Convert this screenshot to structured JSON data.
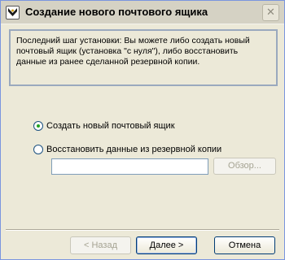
{
  "window": {
    "title": "Создание нового почтового ящика",
    "close_label": "✕"
  },
  "info": {
    "text": "Последний шаг установки: Вы можете либо создать новый почтовый ящик (установка \"с нуля\"), либо восстановить данные из ранее сделанной резервной копии."
  },
  "options": {
    "create_label": "Создать новый почтовый ящик",
    "restore_label": "Восстановить данные из резервной копии",
    "selected": "create"
  },
  "backup_path": {
    "value": ""
  },
  "buttons": {
    "browse_label": "Обзор...",
    "back_label": "< Назад",
    "next_label": "Далее >",
    "cancel_label": "Отмена"
  }
}
